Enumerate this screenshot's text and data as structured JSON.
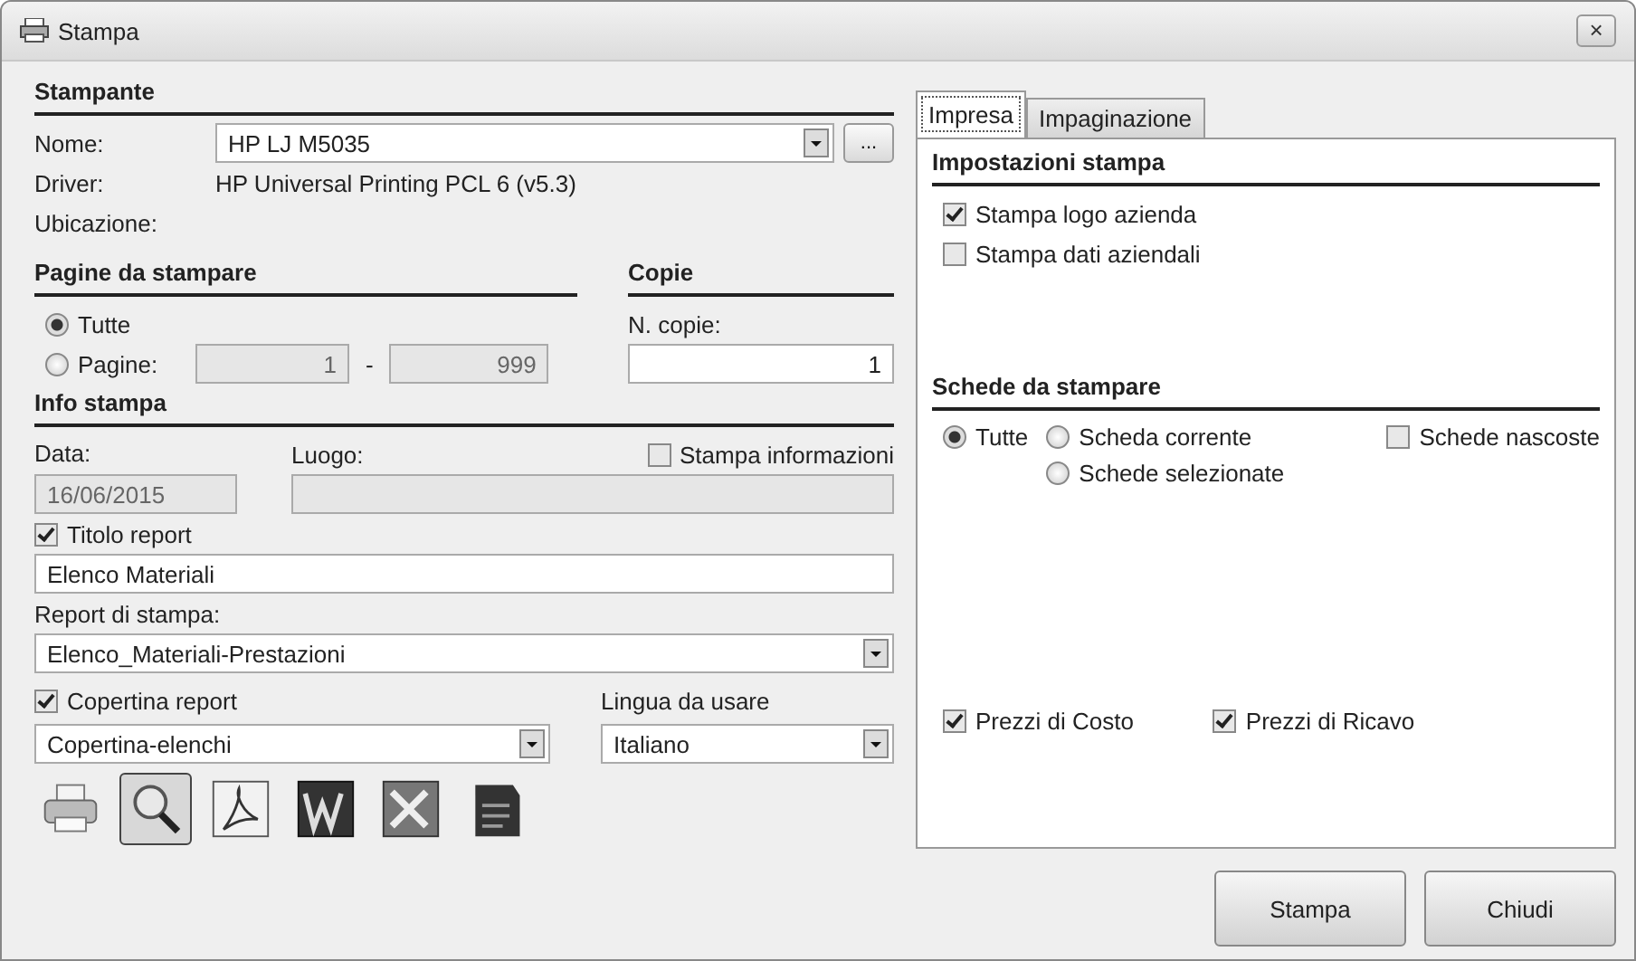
{
  "window": {
    "title": "Stampa",
    "close": "×"
  },
  "printer": {
    "heading": "Stampante",
    "name_label": "Nome:",
    "name_value": "HP LJ M5035",
    "browse_button": "...",
    "driver_label": "Driver:",
    "driver_value": "HP Universal Printing PCL 6 (v5.3)",
    "location_label": "Ubicazione:"
  },
  "pages": {
    "heading": "Pagine da stampare",
    "options": [
      {
        "label": "Tutte",
        "selected": true
      },
      {
        "label": "Pagine:",
        "selected": false
      }
    ],
    "from": "1",
    "separator": "-",
    "to": "999"
  },
  "copies": {
    "heading": "Copie",
    "label": "N. copie:",
    "value": "1"
  },
  "info": {
    "heading": "Info stampa",
    "date_label": "Data:",
    "date_value": "16/06/2015",
    "place_label": "Luogo:",
    "print_info": {
      "label": "Stampa informazioni",
      "checked": false
    },
    "title_check": {
      "label": "Titolo report",
      "checked": true
    },
    "title_value": "Elenco Materiali",
    "report_label": "Report di stampa:",
    "report_value": "Elenco_Materiali-Prestazioni",
    "cover_check": {
      "label": "Copertina report",
      "checked": true
    },
    "cover_value": "Copertina-elenchi",
    "language_label": "Lingua da usare",
    "language_value": "Italiano"
  },
  "export_buttons": [
    {
      "kind": "printer",
      "selected": false
    },
    {
      "kind": "preview",
      "selected": true
    },
    {
      "kind": "pdf",
      "selected": false
    },
    {
      "kind": "word",
      "selected": false
    },
    {
      "kind": "excel",
      "selected": false
    },
    {
      "kind": "document",
      "selected": false
    }
  ],
  "tabs": [
    {
      "label": "Impresa",
      "selected": true
    },
    {
      "label": "Impaginazione",
      "selected": false
    }
  ],
  "settings": {
    "heading": "Impostazioni stampa",
    "options": [
      {
        "label": "Stampa logo azienda",
        "checked": true
      },
      {
        "label": "Stampa dati aziendali",
        "checked": false
      }
    ]
  },
  "sheets": {
    "heading": "Schede da stampare",
    "options": [
      {
        "label": "Tutte",
        "selected": true
      },
      {
        "label": "Scheda corrente",
        "selected": false
      },
      {
        "label": "Schede selezionate",
        "selected": false
      }
    ],
    "hidden": {
      "label": "Schede nascoste",
      "checked": false
    }
  },
  "prices": [
    {
      "label": "Prezzi di Costo",
      "checked": true
    },
    {
      "label": "Prezzi di Ricavo",
      "checked": true
    }
  ],
  "buttons": [
    {
      "label": "Stampa"
    },
    {
      "label": "Chiudi"
    }
  ]
}
